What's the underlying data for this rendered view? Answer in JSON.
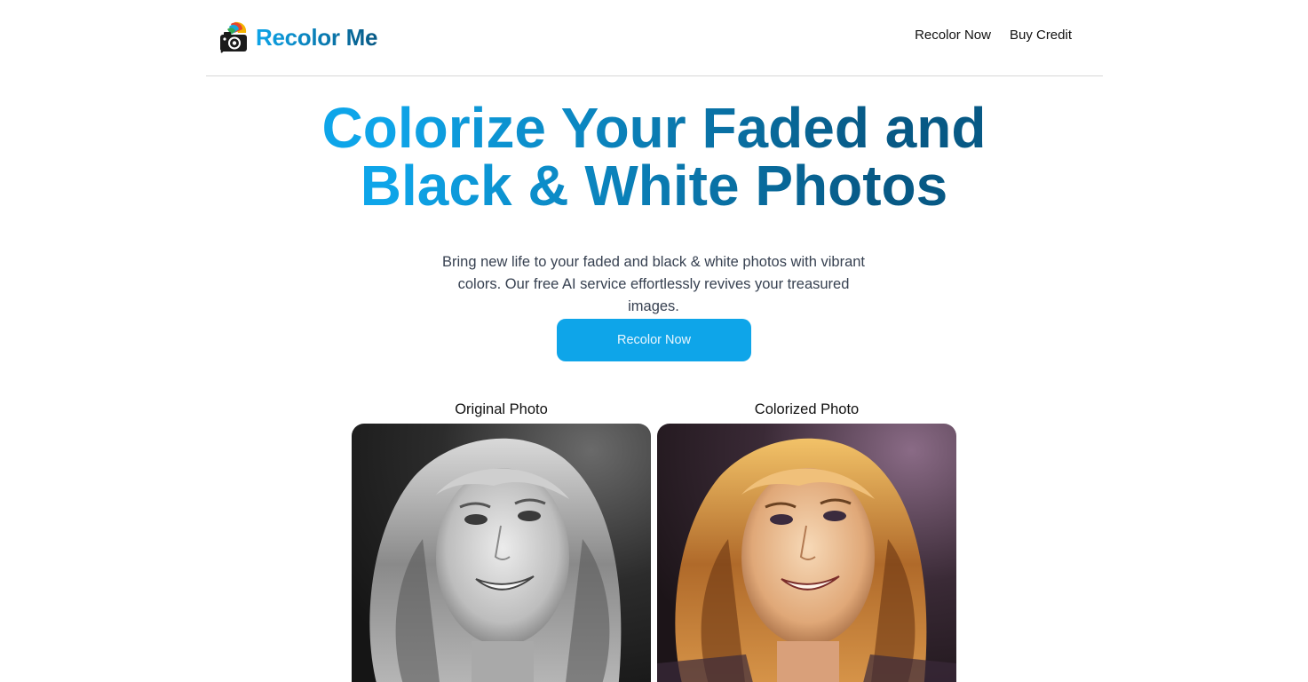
{
  "header": {
    "brand_name": "Recolor Me",
    "logo_icon": "camera-palette-icon",
    "nav": [
      {
        "label": "Recolor Now"
      },
      {
        "label": "Buy Credit"
      }
    ]
  },
  "hero": {
    "title_line1": "Colorize Your Faded and",
    "title_line2": "Black & White Photos",
    "subtitle_line1": "Bring new life to your faded and black & white photos with vibrant",
    "subtitle_line2": "colors. Our free AI service effortlessly revives your treasured images.",
    "cta_label": "Recolor Now"
  },
  "comparison": {
    "original_caption": "Original Photo",
    "colorized_caption": "Colorized Photo"
  },
  "colors": {
    "accent": "#0ea5e9",
    "accent_dark": "#075985",
    "body_text": "#374151"
  }
}
